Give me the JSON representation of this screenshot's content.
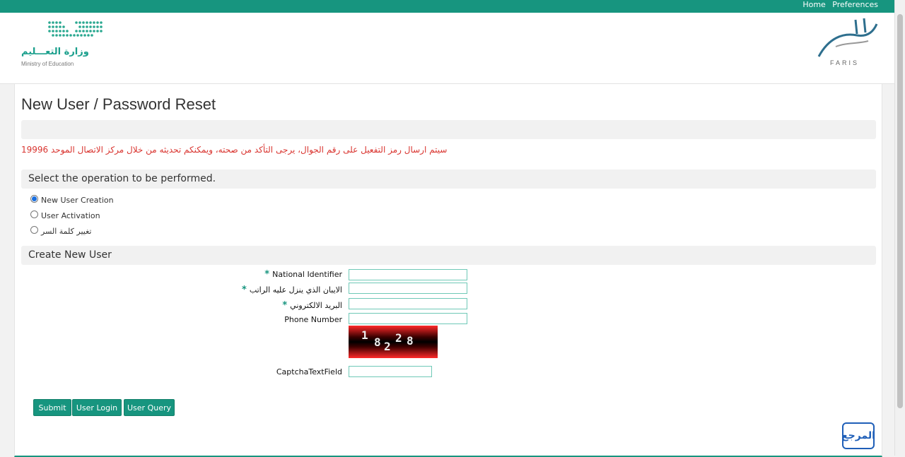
{
  "topbar": {
    "home": "Home",
    "preferences": "Preferences"
  },
  "logos": {
    "moe_ar": "وزارة التعـــليم",
    "moe_en": "Ministry of Education",
    "faris": "FARIS"
  },
  "page": {
    "title": "New User / Password Reset",
    "notice": "سيتم ارسال رمز التفعيل على رقم الجوال، يرجى التأكد من صحته، ويمكنكم تحديثه من خلال مركز الاتصال الموحد 19996"
  },
  "operation": {
    "heading": "Select the operation to be performed.",
    "options": [
      {
        "label": "New User Creation",
        "checked": true
      },
      {
        "label": "User Activation",
        "checked": false
      },
      {
        "label": "تغيير كلمة السر",
        "checked": false
      }
    ]
  },
  "form": {
    "heading": "Create New User",
    "fields": [
      {
        "label": "National Identifier",
        "required": true,
        "value": ""
      },
      {
        "label": "الايبان الذي ينزل عليه الراتب",
        "required": true,
        "value": ""
      },
      {
        "label": "البريد الالكتروني",
        "required": true,
        "value": ""
      },
      {
        "label": "Phone Number",
        "required": false,
        "value": ""
      }
    ],
    "captcha_digits": [
      "1",
      "8",
      "2",
      "2",
      "8"
    ],
    "captcha_label": "CaptchaTextField",
    "captcha_value": ""
  },
  "buttons": {
    "submit": "Submit",
    "user_login": "User Login",
    "user_query": "User Query"
  },
  "watermark": "المرجع",
  "colors": {
    "accent": "#17957f",
    "notice": "#d9342f"
  }
}
